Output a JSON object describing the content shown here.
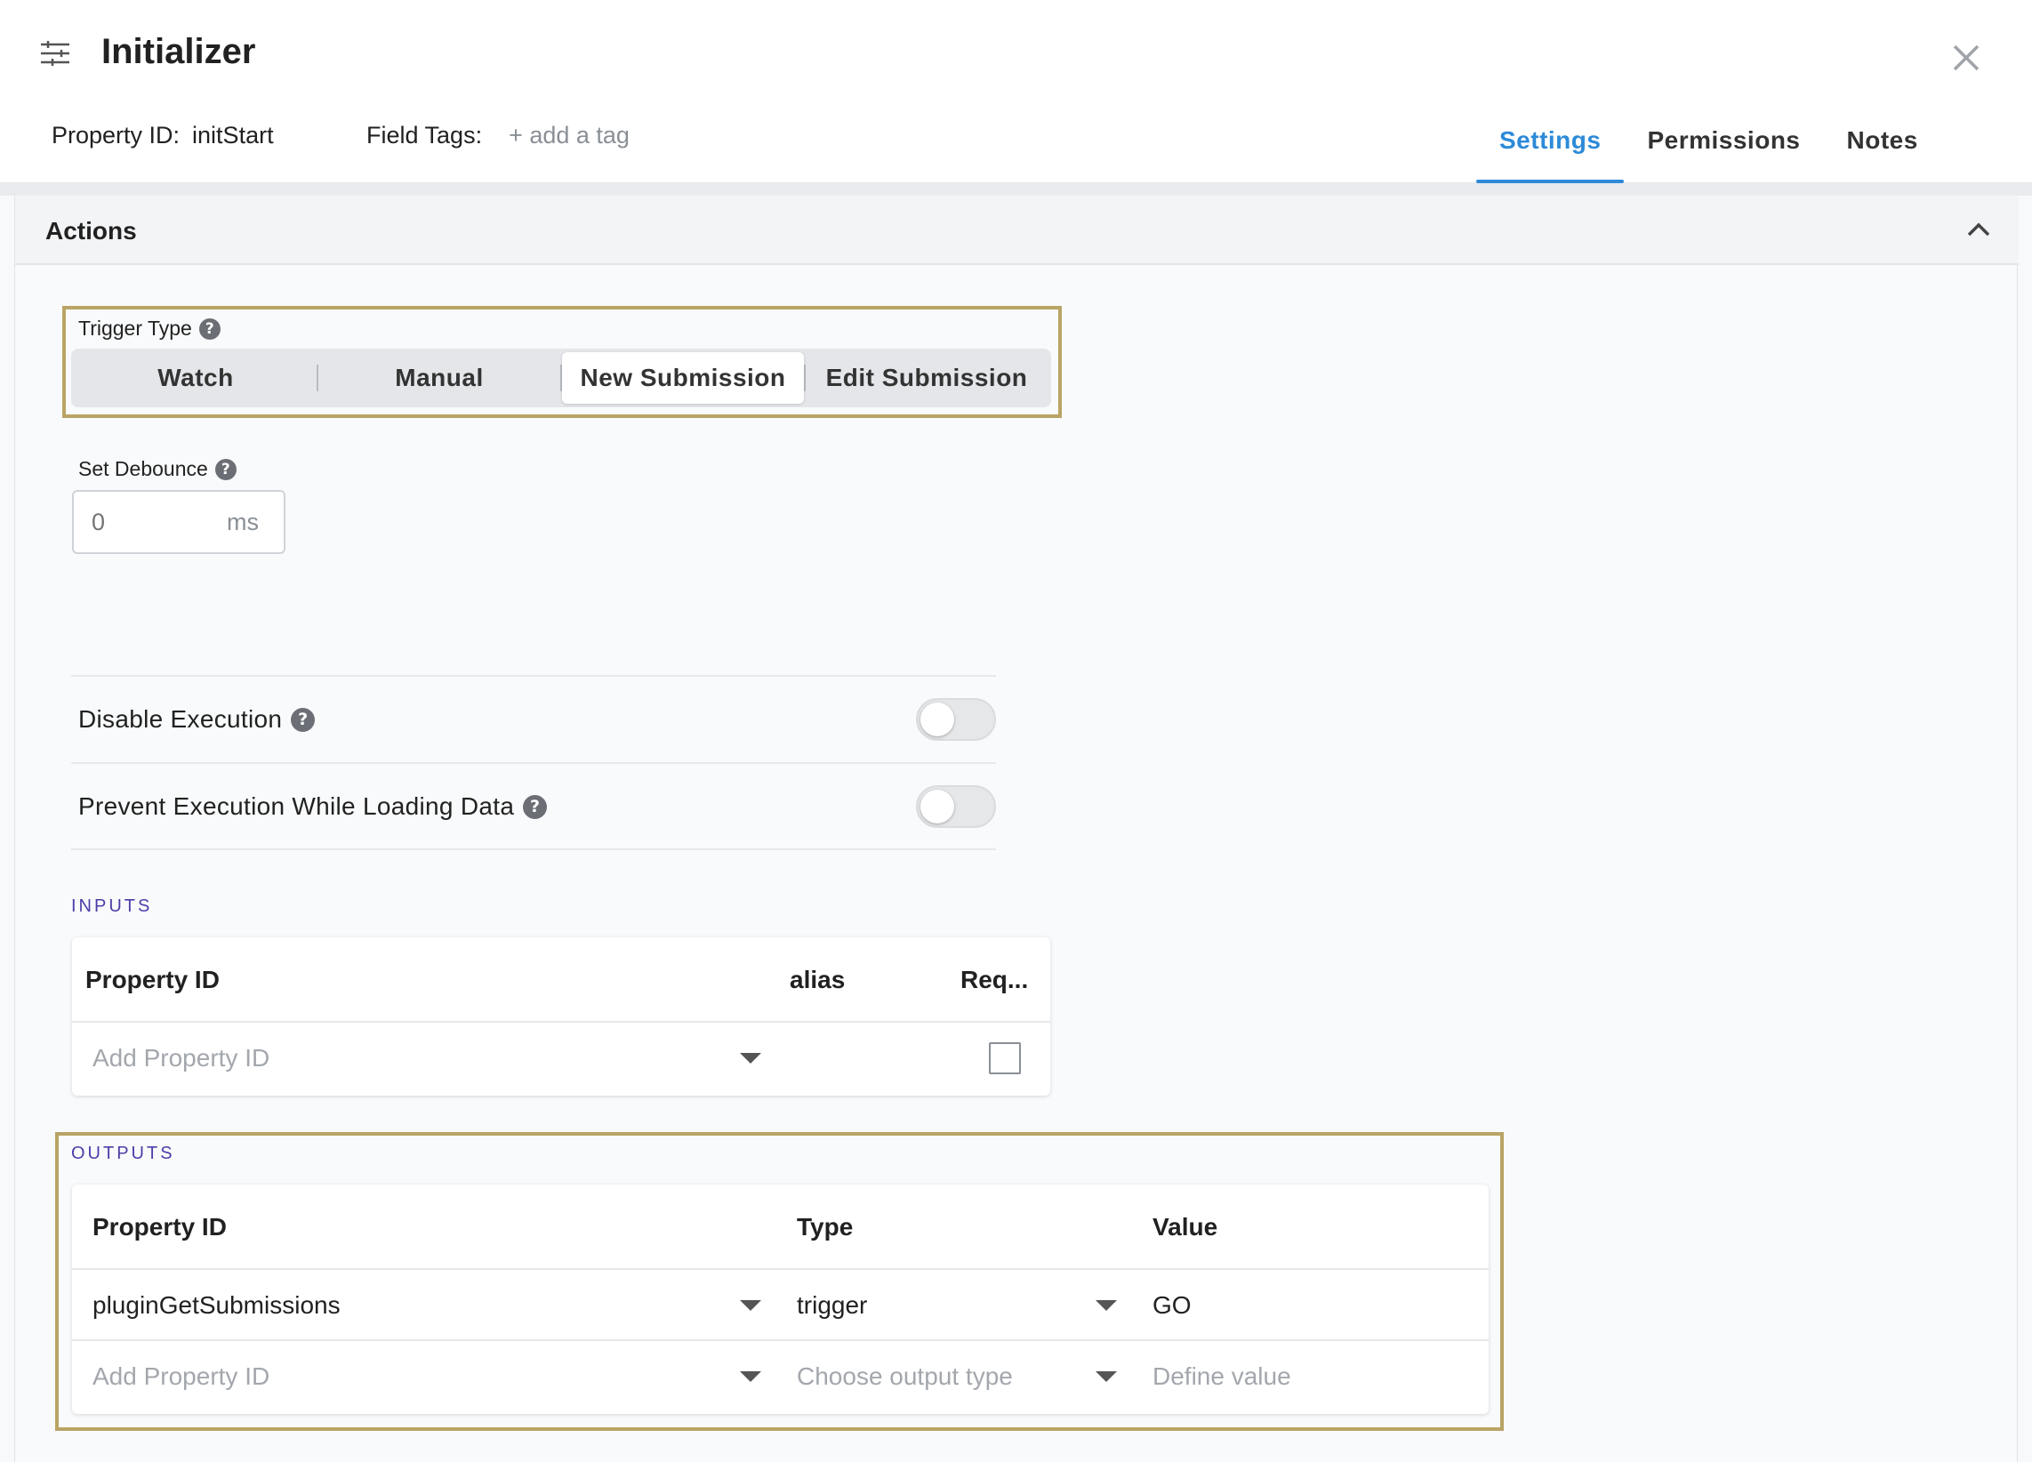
{
  "header": {
    "title": "Initializer",
    "property_id_label": "Property ID:",
    "property_id_value": "initStart",
    "field_tags_label": "Field Tags:",
    "add_tag_label": "+ add a tag",
    "tabs": [
      {
        "label": "Settings",
        "active": true
      },
      {
        "label": "Permissions",
        "active": false
      },
      {
        "label": "Notes",
        "active": false
      }
    ]
  },
  "actions": {
    "title": "Actions",
    "trigger_type": {
      "label": "Trigger Type",
      "options": [
        "Watch",
        "Manual",
        "New Submission",
        "Edit Submission"
      ],
      "selected": "New Submission"
    },
    "debounce": {
      "label": "Set Debounce",
      "placeholder": "0",
      "unit": "ms"
    },
    "toggles": [
      {
        "label": "Disable Execution",
        "on": false
      },
      {
        "label": "Prevent Execution While Loading Data",
        "on": false
      }
    ],
    "inputs": {
      "section_label": "INPUTS",
      "columns": [
        "Property ID",
        "alias",
        "Req..."
      ],
      "rows": [
        {
          "property_id": "Add Property ID",
          "placeholder": true,
          "required": false
        }
      ]
    },
    "outputs": {
      "section_label": "OUTPUTS",
      "columns": [
        "Property ID",
        "Type",
        "Value"
      ],
      "rows": [
        {
          "property_id": "pluginGetSubmissions",
          "type": "trigger",
          "value": "GO",
          "placeholder": false
        },
        {
          "property_id": "Add Property ID",
          "type": "Choose output type",
          "value": "Define value",
          "placeholder": true
        }
      ]
    }
  },
  "colors": {
    "accent": "#2d8ad8",
    "highlight_border": "#b9a465",
    "section_label": "#4a3ea8"
  },
  "icons": [
    "sliders-icon",
    "close-icon",
    "chevron-up-icon",
    "help-icon",
    "caret-down-icon",
    "checkbox"
  ]
}
